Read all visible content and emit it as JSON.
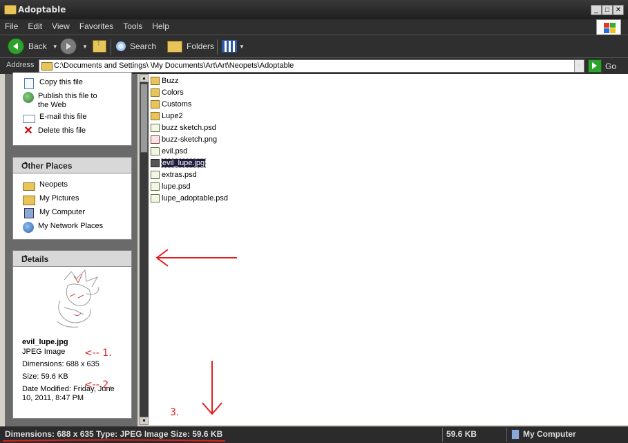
{
  "window": {
    "title": "Adoptable"
  },
  "menu": [
    "File",
    "Edit",
    "View",
    "Favorites",
    "Tools",
    "Help"
  ],
  "toolbar": {
    "back": "Back",
    "search": "Search",
    "folders": "Folders"
  },
  "address": {
    "label": "Address",
    "path": "C:\\Documents and Settings\\      \\My Documents\\Art\\Art\\Neopets\\Adoptable",
    "go": "Go"
  },
  "file_tasks": [
    "Copy this file",
    "Publish this file to the Web",
    "E-mail this file",
    "Delete this file"
  ],
  "other_places": {
    "title": "Other Places",
    "items": [
      "Neopets",
      "My Pictures",
      "My Computer",
      "My Network Places"
    ]
  },
  "details": {
    "title": "Details",
    "filename": "evil_lupe.jpg",
    "type": "JPEG Image",
    "dimensions": "Dimensions: 688 x 635",
    "size": "Size: 59.6 KB",
    "modified": "Date Modified: Friday, June 10, 2011, 8:47 PM"
  },
  "files": [
    {
      "name": "Buzz",
      "kind": "folder"
    },
    {
      "name": "Colors",
      "kind": "folder"
    },
    {
      "name": "Customs",
      "kind": "folder"
    },
    {
      "name": "Lupe2",
      "kind": "folder"
    },
    {
      "name": "buzz sketch.psd",
      "kind": "psd"
    },
    {
      "name": "buzz-sketch.png",
      "kind": "png"
    },
    {
      "name": "evil.psd",
      "kind": "psd"
    },
    {
      "name": "evil_lupe.jpg",
      "kind": "jpg",
      "selected": true
    },
    {
      "name": "extras.psd",
      "kind": "psd"
    },
    {
      "name": "lupe.psd",
      "kind": "psd"
    },
    {
      "name": "lupe_adoptable.psd",
      "kind": "psd"
    }
  ],
  "status": {
    "info": "Dimensions: 688 x 635 Type: JPEG Image Size: 59.6 KB",
    "size": "59.6 KB",
    "location": "My Computer"
  },
  "annotations": {
    "a1": "<-- 1.",
    "a2": "<-- 2.",
    "a3": "3."
  },
  "colors": {
    "annotation_red": "#e02020",
    "selection": "#1f1f3f"
  }
}
